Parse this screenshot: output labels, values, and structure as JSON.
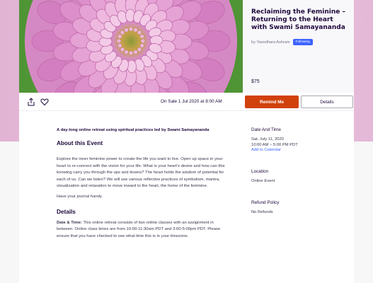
{
  "theme": {
    "accent": "#d1410c",
    "link": "#3d64ff",
    "follow": "#3d64ff"
  },
  "event": {
    "title": "Reclaiming the Feminine – Returning to the Heart with Swami Samayananda",
    "organizer": "by Yasodhara Ashram",
    "follow_label": "Following",
    "price": "$75",
    "hero_image": "pink-dahlia-flower"
  },
  "actions": {
    "share_icon": "share-icon",
    "like_icon": "heart-icon",
    "sale_text": "On Sale 1 Jul 2020 at 8:00 AM",
    "remind_label": "Remind Me",
    "details_label": "Details"
  },
  "main": {
    "summary": "A day-long online retreat using spiritual practices led by Swami Samayananda",
    "about_heading": "About this Event",
    "about_p1": "Explore the inner feminine power to create the life you want to live. Open up space in your heart to re-connect with the vision for your life. What is your heart’s desire and how can this knowing carry you through the ups and downs? The heart holds the wisdom of potential for each of us. Can we listen? We will use various reflective practices of symbolism, mantra, visualization and relaxation to move inward to the heart, the home of the feminine.",
    "about_p2": "Have your journal handy.",
    "details_heading": "Details",
    "details_label": "Date & Time:",
    "details_text": " This online retreat consists of two online classes with an assignment in between. Online class times are from 10:00-11:30am PDT and 3:00-5:00pm PDT. Please ensure that you have checked to see what time this is in your timezone."
  },
  "sidebar": {
    "date_heading": "Date And Time",
    "date_line": "Sat, July 11, 2020",
    "time_line": "10:00 AM – 5:00 PM PDT",
    "calendar_link": "Add to Calendar",
    "location_heading": "Location",
    "location_value": "Online Event",
    "refund_heading": "Refund Policy",
    "refund_value": "No Refunds"
  }
}
